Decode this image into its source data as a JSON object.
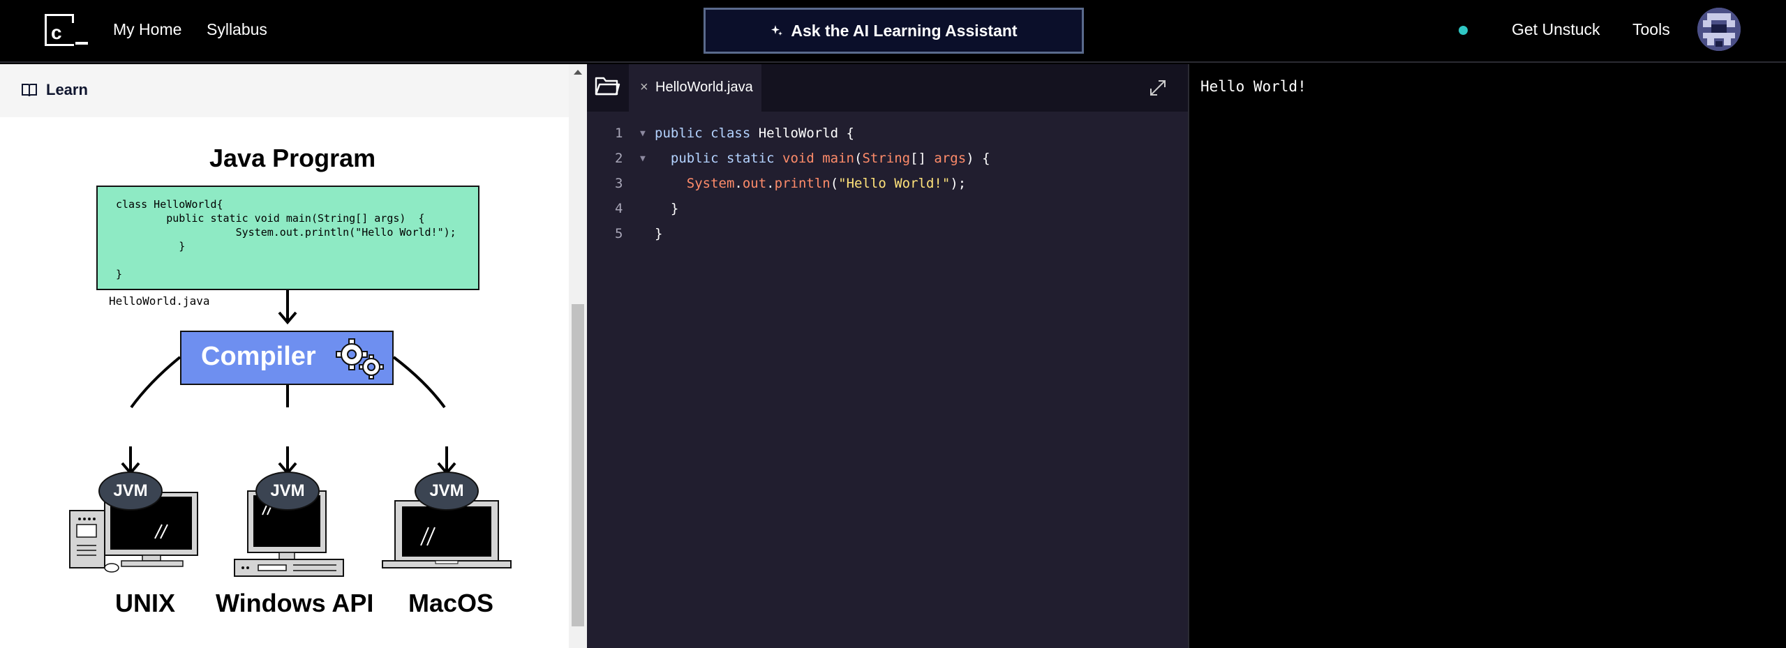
{
  "nav": {
    "logo_letter": "c",
    "my_home": "My Home",
    "syllabus": "Syllabus",
    "ai_button": "Ask the AI Learning Assistant",
    "get_unstuck": "Get Unstuck",
    "tools": "Tools",
    "status_color": "#2fc7c4"
  },
  "learn": {
    "header": "Learn",
    "diagram": {
      "title": "Java Program",
      "code_lines": [
        "class HelloWorld{",
        "        public static void main(String[] args)  {",
        "                   System.out.println(\"Hello World!\");",
        "          }",
        "",
        "}"
      ],
      "file_label": "HelloWorld.java",
      "compiler": "Compiler",
      "jvm_labels": [
        "JVM",
        "JVM",
        "JVM"
      ],
      "os_labels": [
        "UNIX",
        "Windows API",
        "MacOS"
      ]
    }
  },
  "editor": {
    "tab_name": "HelloWorld.java",
    "lines": [
      {
        "num": "1",
        "fold": "▼",
        "tokens": [
          [
            "kw",
            "public class "
          ],
          [
            "pl",
            "HelloWorld {"
          ]
        ]
      },
      {
        "num": "2",
        "fold": "▼",
        "tokens": [
          [
            "kw",
            "  public static "
          ],
          [
            "ty",
            "void "
          ],
          [
            "fn",
            "main"
          ],
          [
            "pl",
            "("
          ],
          [
            "ty",
            "String"
          ],
          [
            "pl",
            "[] "
          ],
          [
            "ty",
            "args"
          ],
          [
            "pl",
            ") {"
          ]
        ]
      },
      {
        "num": "3",
        "fold": "",
        "tokens": [
          [
            "ty",
            "    System"
          ],
          [
            "pl",
            "."
          ],
          [
            "ty",
            "out"
          ],
          [
            "pl",
            "."
          ],
          [
            "fn",
            "println"
          ],
          [
            "pl",
            "("
          ],
          [
            "str",
            "\"Hello World!\""
          ],
          [
            "pl",
            ");"
          ]
        ]
      },
      {
        "num": "4",
        "fold": "",
        "tokens": [
          [
            "pl",
            "  }"
          ]
        ]
      },
      {
        "num": "5",
        "fold": "",
        "tokens": [
          [
            "pl",
            "}"
          ]
        ]
      }
    ]
  },
  "output": {
    "text": "Hello World!"
  }
}
